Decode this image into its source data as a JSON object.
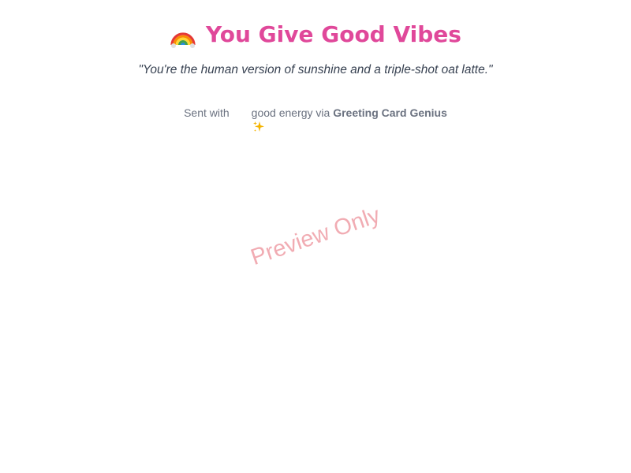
{
  "card": {
    "title": "You Give Good Vibes",
    "title_icon": "rainbow-icon",
    "title_color": "#e0489a",
    "quote": "\"You're the human version of sunshine and a triple-shot oat latte.\"",
    "footer": {
      "prefix": "Sent with",
      "icon": "sparkles-icon",
      "middle": "good energy via",
      "brand": "Greeting Card Genius"
    }
  },
  "watermark": {
    "text": "Preview Only",
    "color": "#ef9ea6"
  }
}
